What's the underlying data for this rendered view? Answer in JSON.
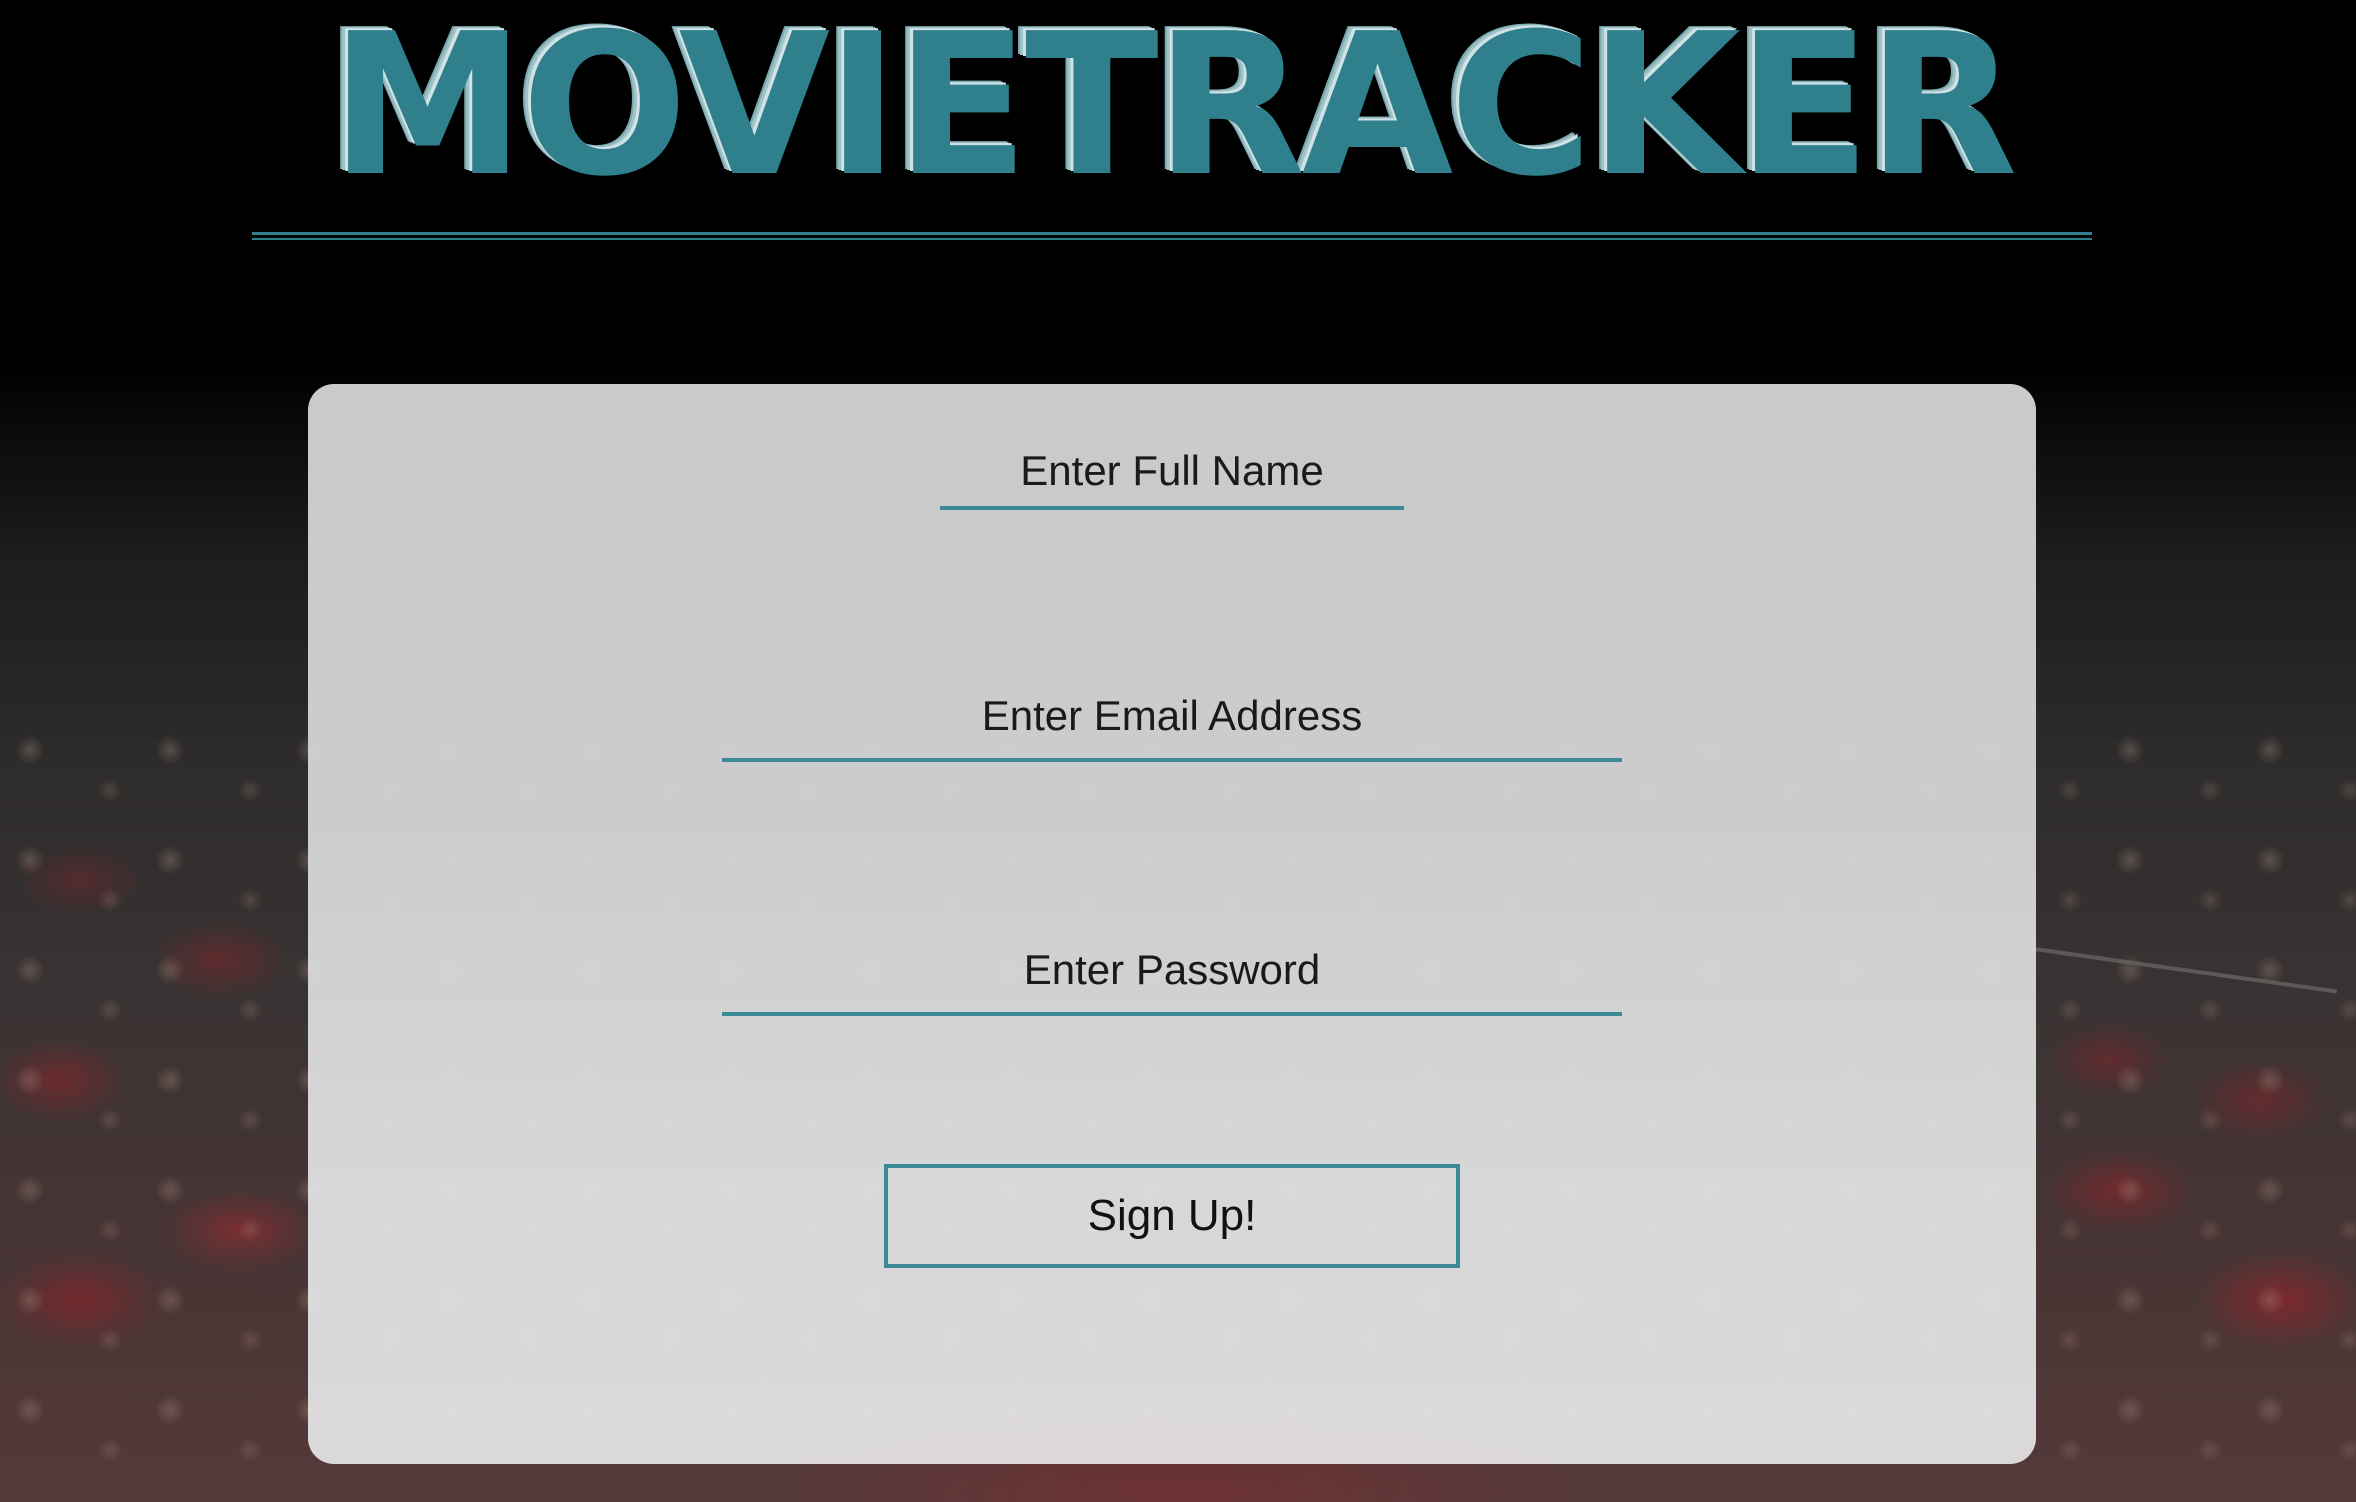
{
  "app": {
    "title": "MOVIETRACKER"
  },
  "signup_form": {
    "full_name": {
      "placeholder": "Enter Full Name",
      "value": ""
    },
    "email": {
      "placeholder": "Enter Email Address",
      "value": ""
    },
    "password": {
      "placeholder": "Enter Password",
      "value": ""
    },
    "submit_label": "Sign Up!"
  },
  "theme": {
    "accent": "#2f7f8c",
    "background": "#000000",
    "card_background": "#d4d4d4"
  }
}
